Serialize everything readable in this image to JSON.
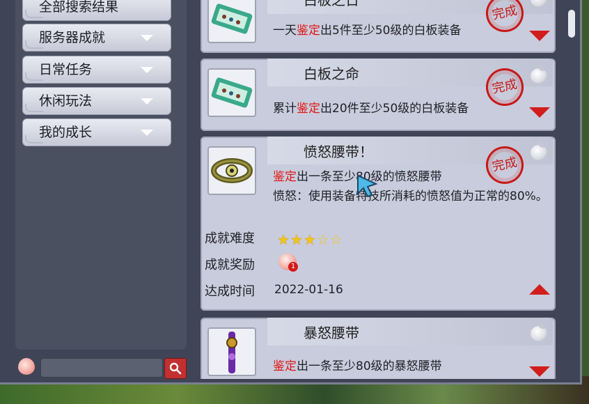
{
  "sidebar": {
    "items": [
      {
        "label": "全部搜索结果"
      },
      {
        "label": "服务器成就"
      },
      {
        "label": "日常任务"
      },
      {
        "label": "休闲玩法"
      },
      {
        "label": "我的成长"
      }
    ]
  },
  "search": {
    "placeholder": ""
  },
  "achievements": [
    {
      "title": "白板之日",
      "desc_pre": "一天",
      "desc_hl": "鉴定",
      "desc_post": "出5件至少50级的白板装备",
      "stamp": "完成",
      "icon": "scroll-icon",
      "expanded": false
    },
    {
      "title": "白板之命",
      "desc_pre": "累计",
      "desc_hl": "鉴定",
      "desc_post": "出20件至少50级的白板装备",
      "stamp": "完成",
      "icon": "scroll-icon",
      "expanded": false
    },
    {
      "title": "愤怒腰带！",
      "desc_pre": "",
      "desc_hl": "鉴定",
      "desc_post": "出一条至少80级的愤怒腰带",
      "desc_extra": "愤怒：使用装备特技所消耗的愤怒值为正常的80%。",
      "stamp": "完成",
      "icon": "belt-icon",
      "expanded": true,
      "details": {
        "difficulty_label": "成就难度",
        "difficulty_stars": 3,
        "difficulty_max": 5,
        "reward_label": "成就奖励",
        "reward_count": "1",
        "time_label": "达成时间",
        "time_value": "2022-01-16"
      }
    },
    {
      "title": "暴怒腰带",
      "desc_pre": "",
      "desc_hl": "鉴定",
      "desc_post": "出一条至少80级的暴怒腰带",
      "icon": "purple-belt-icon",
      "expanded": false
    }
  ],
  "colors": {
    "highlight": "#e01818",
    "stamp": "#c81818",
    "panel": "#3f4556",
    "card": "#c9ccdc"
  }
}
